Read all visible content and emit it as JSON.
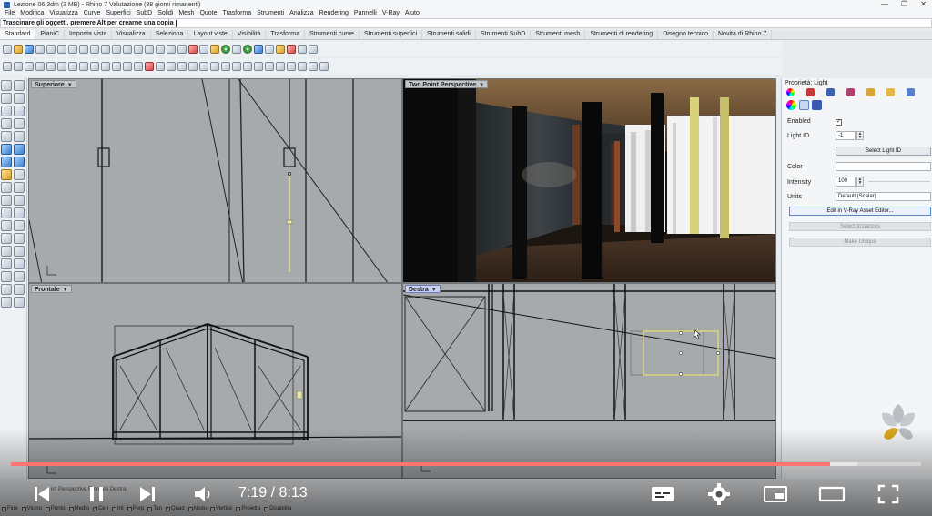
{
  "window": {
    "title": "Lezione 06.3dm (3 MB) - Rhino 7 Valutazione (88 giorni rimanenti)",
    "controls": [
      "—",
      "❐",
      "✕"
    ]
  },
  "menu": [
    "File",
    "Modifica",
    "Visualizza",
    "Curve",
    "Superfici",
    "SubD",
    "Solidi",
    "Mesh",
    "Quote",
    "Trasforma",
    "Strumenti",
    "Analizza",
    "Rendering",
    "Pannelli",
    "V-Ray",
    "Aiuto"
  ],
  "command_prompt": "Trascinare gli oggetti, premere Alt per crearne una copia",
  "tabs": [
    "Standard",
    "PianiC",
    "Imposta vista",
    "Visualizza",
    "Seleziona",
    "Layout viste",
    "Visibilità",
    "Trasforma",
    "Strumenti curve",
    "Strumenti superfici",
    "Strumenti solidi",
    "Strumenti SubD",
    "Strumenti mesh",
    "Strumenti di rendering",
    "Disegno tecnico",
    "Novità di Rhino 7"
  ],
  "active_tab_index": 0,
  "viewports": [
    {
      "label": "Superiore",
      "active": false
    },
    {
      "label": "Two Point Perspective",
      "active": false
    },
    {
      "label": "Frontale",
      "active": false
    },
    {
      "label": "Destra",
      "active": true
    }
  ],
  "properties": {
    "title": "Proprietà: Light",
    "enabled_label": "Enabled",
    "enabled_checked": "✓",
    "light_id_label": "Light ID",
    "light_id_value": "-1",
    "select_light_id": "Select Light ID",
    "color_label": "Color",
    "color_value": "#ffffff",
    "intensity_label": "Intensity",
    "intensity_value": "100",
    "units_label": "Units",
    "units_value": "Default (Scalar)",
    "edit_button": "Edit in V-Ray Asset Editor...",
    "select_instances": "Select Instances",
    "make_unique": "Make Unique"
  },
  "status_osnaps": [
    "Fine",
    "Vicino",
    "Punto",
    "Medio",
    "Cen",
    "Int",
    "Perp",
    "Tan",
    "Quad",
    "Nodo",
    "Vertice",
    "Proietta",
    "Disabilita"
  ],
  "video": {
    "current_time": "7:19",
    "duration": "8:13",
    "time_display": "7:19 / 8:13",
    "progress": 0.9,
    "buffered": 0.93
  },
  "bottom_tabs_peek": "int Perspective   Frontale   Destra"
}
